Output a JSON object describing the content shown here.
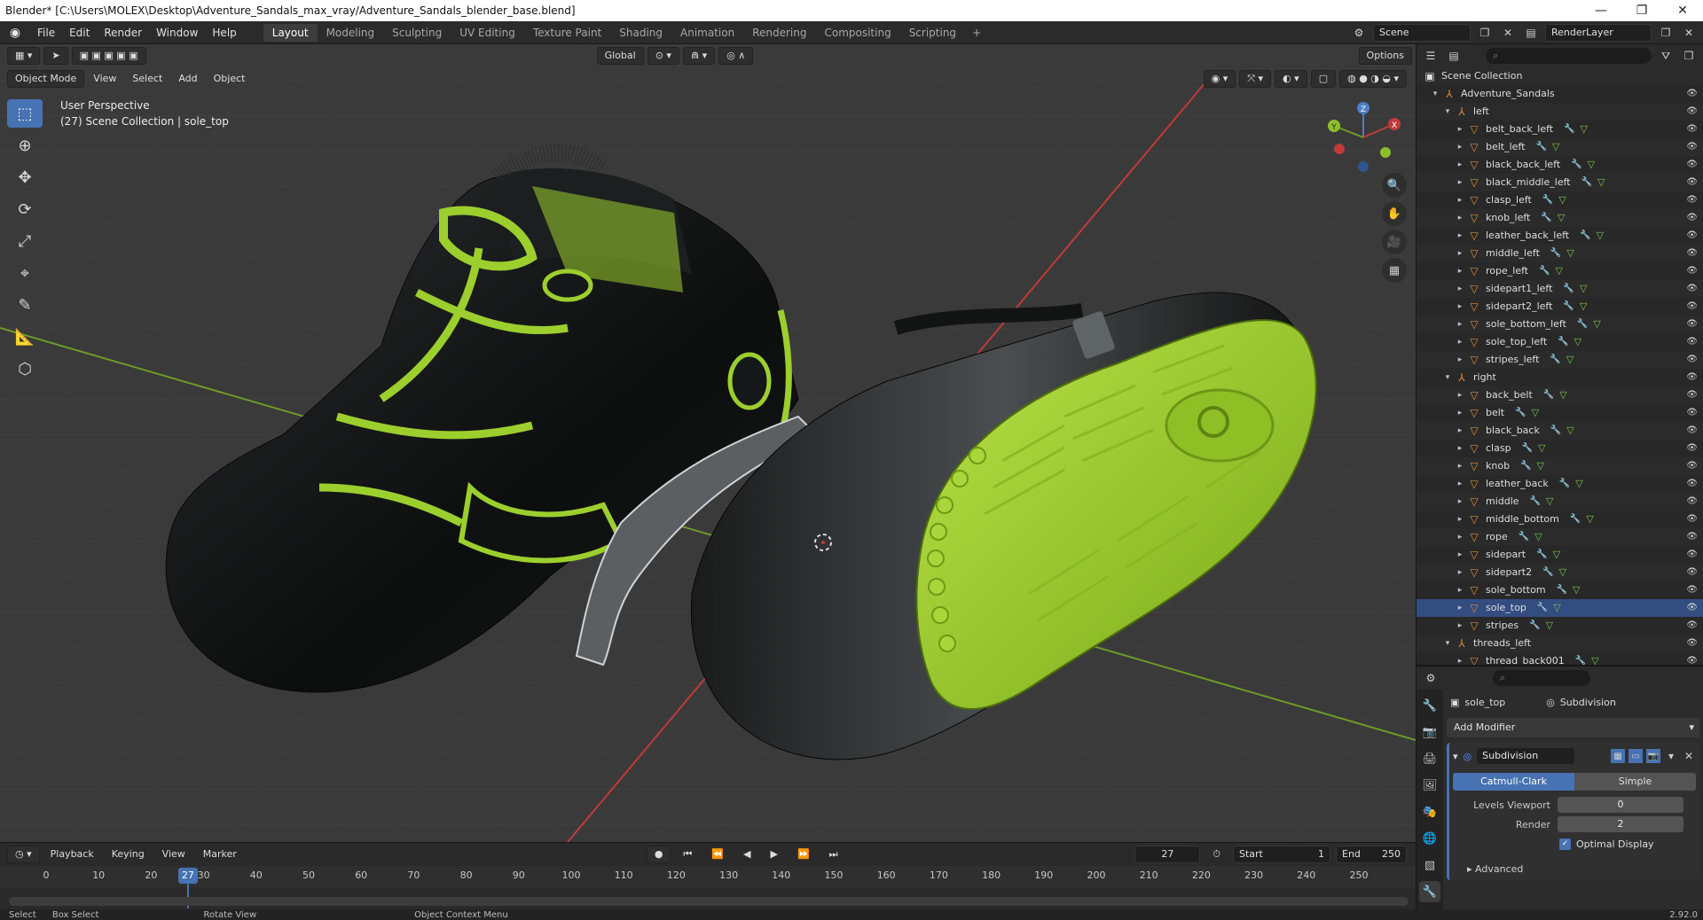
{
  "window": {
    "title": "Blender* [C:\\Users\\MOLEX\\Desktop\\Adventure_Sandals_max_vray/Adventure_Sandals_blender_base.blend]",
    "min": "—",
    "max": "❐",
    "close": "✕"
  },
  "menu": [
    "File",
    "Edit",
    "Render",
    "Window",
    "Help"
  ],
  "workspaces": [
    "Layout",
    "Modeling",
    "Sculpting",
    "UV Editing",
    "Texture Paint",
    "Shading",
    "Animation",
    "Rendering",
    "Compositing",
    "Scripting"
  ],
  "workspace_add": "+",
  "scene": {
    "name": "Scene",
    "render_layer": "RenderLayer"
  },
  "viewport": {
    "mode": "Object Mode",
    "header_menus": [
      "View",
      "Select",
      "Add",
      "Object"
    ],
    "orientation": "Global",
    "options": "Options",
    "info_line1": "User Perspective",
    "info_line2": "(27) Scene Collection | sole_top",
    "gizmo": {
      "x": "X",
      "y": "Y",
      "z": "Z"
    }
  },
  "timeline": {
    "menus": [
      "Playback",
      "Keying",
      "View",
      "Marker"
    ],
    "current_frame": "27",
    "start_label": "Start",
    "start": "1",
    "end_label": "End",
    "end": "250",
    "ticks": [
      "0",
      "10",
      "20",
      "30",
      "40",
      "50",
      "60",
      "70",
      "80",
      "90",
      "100",
      "110",
      "120",
      "130",
      "140",
      "150",
      "160",
      "170",
      "180",
      "190",
      "200",
      "210",
      "220",
      "230",
      "240",
      "250"
    ]
  },
  "statusbar": {
    "select": "Select",
    "box_select": "Box Select",
    "rotate": "Rotate View",
    "context": "Object Context Menu",
    "version": "2.92.0"
  },
  "outliner": {
    "root": "Scene Collection",
    "rows": [
      {
        "label": "Adventure_Sandals",
        "type": "empty"
      },
      {
        "label": "left",
        "type": "empty"
      },
      {
        "label": "belt_back_left",
        "type": "mesh"
      },
      {
        "label": "belt_left",
        "type": "mesh"
      },
      {
        "label": "black_back_left",
        "type": "mesh"
      },
      {
        "label": "black_middle_left",
        "type": "mesh"
      },
      {
        "label": "clasp_left",
        "type": "mesh"
      },
      {
        "label": "knob_left",
        "type": "mesh"
      },
      {
        "label": "leather_back_left",
        "type": "mesh"
      },
      {
        "label": "middle_left",
        "type": "mesh"
      },
      {
        "label": "rope_left",
        "type": "mesh"
      },
      {
        "label": "sidepart1_left",
        "type": "mesh"
      },
      {
        "label": "sidepart2_left",
        "type": "mesh"
      },
      {
        "label": "sole_bottom_left",
        "type": "mesh"
      },
      {
        "label": "sole_top_left",
        "type": "mesh"
      },
      {
        "label": "stripes_left",
        "type": "mesh"
      },
      {
        "label": "right",
        "type": "empty"
      },
      {
        "label": "back_belt",
        "type": "mesh"
      },
      {
        "label": "belt",
        "type": "mesh"
      },
      {
        "label": "black_back",
        "type": "mesh"
      },
      {
        "label": "clasp",
        "type": "mesh"
      },
      {
        "label": "knob",
        "type": "mesh"
      },
      {
        "label": "leather_back",
        "type": "mesh"
      },
      {
        "label": "middle",
        "type": "mesh"
      },
      {
        "label": "middle_bottom",
        "type": "mesh"
      },
      {
        "label": "rope",
        "type": "mesh"
      },
      {
        "label": "sidepart",
        "type": "mesh"
      },
      {
        "label": "sidepart2",
        "type": "mesh"
      },
      {
        "label": "sole_bottom",
        "type": "mesh"
      },
      {
        "label": "sole_top",
        "type": "mesh",
        "selected": true
      },
      {
        "label": "stripes",
        "type": "mesh"
      },
      {
        "label": "threads_left",
        "type": "empty"
      },
      {
        "label": "thread_back001",
        "type": "mesh"
      }
    ]
  },
  "properties": {
    "object": "sole_top",
    "modifier_crumb": "Subdivision",
    "add_modifier": "Add Modifier",
    "modifier": {
      "name": "Subdivision",
      "types": [
        "Catmull-Clark",
        "Simple"
      ],
      "active_type": "Catmull-Clark",
      "levels_viewport_label": "Levels Viewport",
      "levels_viewport": "0",
      "render_label": "Render",
      "render": "2",
      "optimal_display": "Optimal Display",
      "advanced": "Advanced"
    }
  },
  "colors": {
    "accent": "#4772b3",
    "sole_green": "#9ccf2e",
    "axis_red": "#c23a3a",
    "axis_green": "#6f9a2a",
    "object_orange": "#e08a38"
  }
}
